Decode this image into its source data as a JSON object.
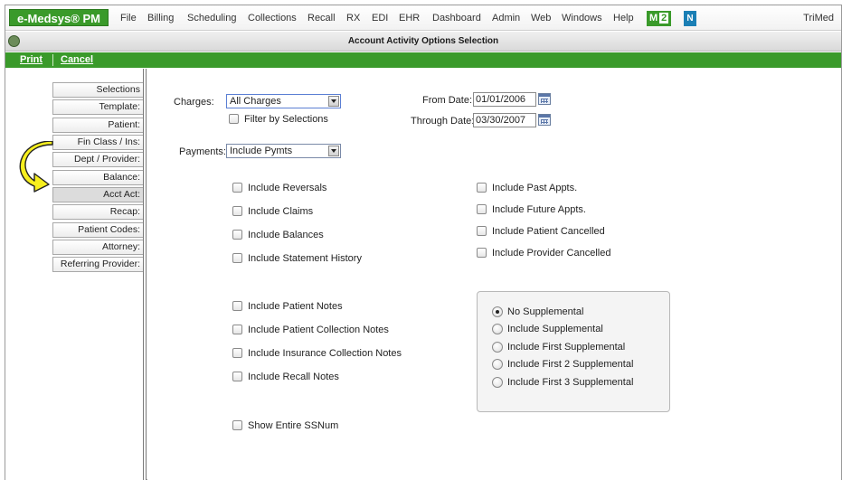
{
  "app": {
    "logo": "e-Medsys® PM",
    "menu": [
      "File",
      "Billing",
      "Scheduling",
      "Collections",
      "Recall",
      "RX",
      "EDI",
      "EHR",
      "Dashboard",
      "Admin",
      "Web",
      "Windows",
      "Help"
    ],
    "badge_m": "M",
    "badge_m_num": "2",
    "badge_n": "N",
    "brand_right": "TriMed"
  },
  "window": {
    "title": "Account Activity Options Selection"
  },
  "actions": {
    "print": "Print",
    "cancel": "Cancel"
  },
  "tabs": [
    "Selections",
    "Template:",
    "Patient:",
    "Fin Class / Ins:",
    "Dept / Provider:",
    "Balance:",
    "Acct Act:",
    "Recap:",
    "Patient Codes:",
    "Attorney:",
    "Referring Provider:"
  ],
  "active_tab": "Acct Act:",
  "form": {
    "charges_label": "Charges:",
    "charges_value": "All Charges",
    "filter_by_selections": "Filter by Selections",
    "payments_label": "Payments:",
    "payments_value": "Include Pymts",
    "from_date_label": "From Date:",
    "from_date": "01/01/2006",
    "through_date_label": "Through Date:",
    "through_date": "03/30/2007",
    "left_checks_1": [
      "Include Reversals",
      "Include Claims",
      "Include Balances",
      "Include Statement History"
    ],
    "right_checks": [
      "Include Past Appts.",
      "Include Future Appts.",
      "Include Patient Cancelled",
      "Include Provider Cancelled"
    ],
    "left_checks_2": [
      "Include Patient Notes",
      "Include Patient Collection Notes",
      "Include Insurance Collection Notes",
      "Include Recall Notes"
    ],
    "show_ssn": "Show Entire SSNum",
    "supplemental": [
      "No Supplemental",
      "Include Supplemental",
      "Include First Supplemental",
      "Include First 2 Supplemental",
      "Include First 3 Supplemental"
    ],
    "supplemental_selected": "No Supplemental"
  },
  "colors": {
    "brand_green": "#3a9a2a",
    "badge_blue": "#1a7fb5",
    "arrow_yellow": "#f7ef1e"
  }
}
